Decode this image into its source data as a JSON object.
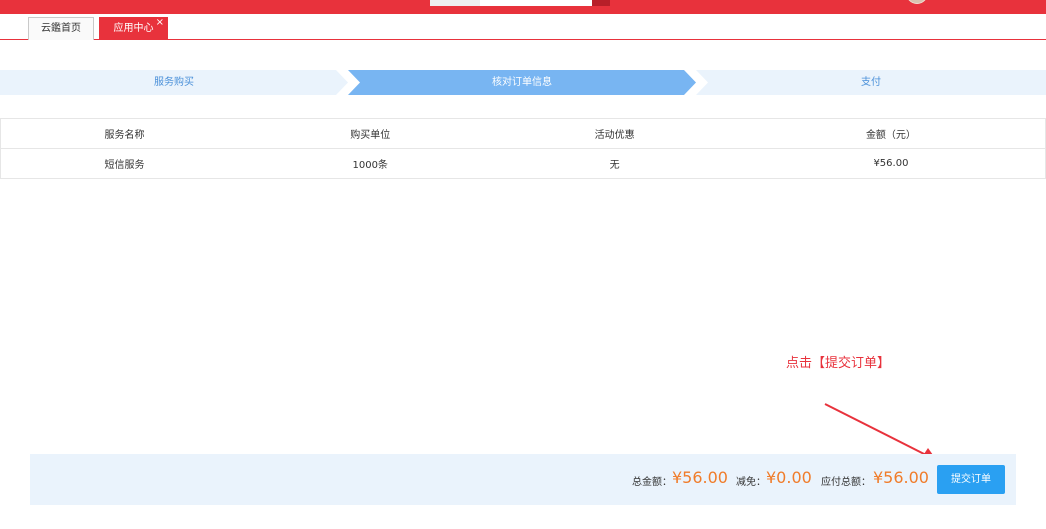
{
  "tabs": [
    {
      "label": "云鑑首页"
    },
    {
      "label": "应用中心",
      "close_glyph": "×"
    }
  ],
  "steps": [
    "服务购买",
    "核对订单信息",
    "支付"
  ],
  "table": {
    "headers": [
      "服务名称",
      "购买单位",
      "活动优惠",
      "金额（元）"
    ],
    "rows": [
      [
        "短信服务",
        "1000条",
        "无",
        "¥56.00"
      ]
    ]
  },
  "annotation": {
    "text": "点击【提交订单】",
    "color": "#e8323c"
  },
  "summary": {
    "total_label": "总金额：",
    "total_value": "¥56.00",
    "discount_label": "减免：",
    "discount_value": "¥0.00",
    "payable_label": "应付总额：",
    "payable_value": "¥56.00",
    "submit_label": "提交订单"
  },
  "colors": {
    "brand_red": "#e8323c",
    "accent_blue": "#2aa0f2",
    "amount_orange": "#f07c2a"
  }
}
